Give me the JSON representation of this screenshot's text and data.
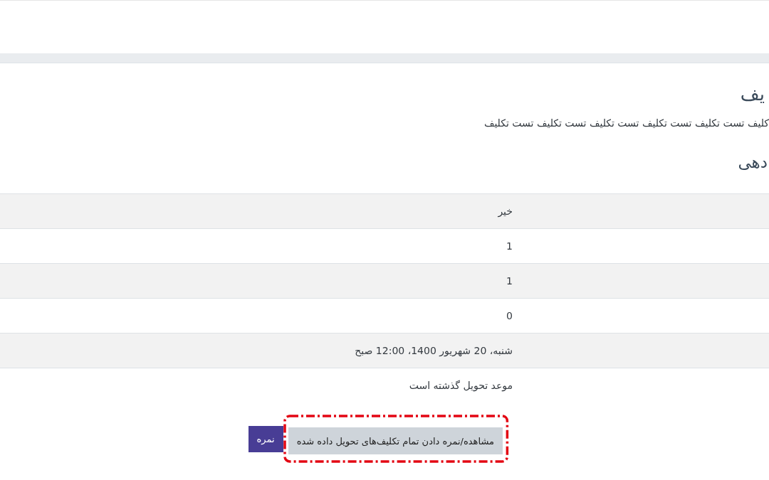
{
  "page_title": "یف",
  "description": "کلیف تست تکلیف تست تکلیف تست تکلیف تست تکلیف تست تکلیف",
  "section_title": "دهی",
  "table": {
    "rows": [
      {
        "value": "خیر"
      },
      {
        "value": "1"
      },
      {
        "value": "1"
      },
      {
        "value": "0"
      },
      {
        "value": "شنبه، 20 شهریور 1400، 12:00 صبح"
      },
      {
        "value": "موعد تحویل گذشته است"
      }
    ]
  },
  "buttons": [
    {
      "label": "مشاهده/نمره دادن تمام تکلیف‌های تحویل داده شده",
      "kind": "secondary",
      "highlighted": true
    },
    {
      "label": "نمره",
      "kind": "primary",
      "highlighted": false
    }
  ]
}
